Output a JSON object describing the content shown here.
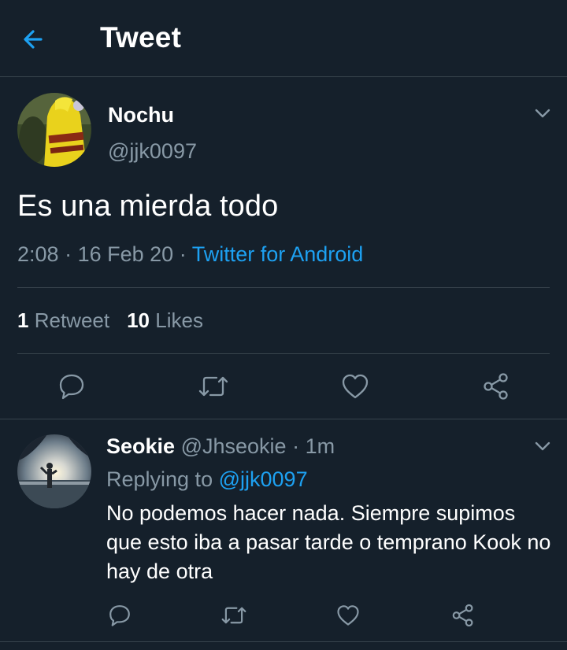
{
  "header": {
    "title": "Tweet",
    "back_icon": "arrow-left-icon"
  },
  "colors": {
    "background": "#15202b",
    "accent": "#1da1f2",
    "secondary_text": "#8899a6",
    "divider": "#38444d"
  },
  "tweet": {
    "author_name": "Nochu",
    "author_handle": "@jjk0097",
    "text": "Es una mierda todo",
    "time": "2:08",
    "date": "16 Feb 20",
    "source": "Twitter for Android",
    "retweet_count": "1",
    "retweet_label": "Retweet",
    "like_count": "10",
    "like_label": "Likes",
    "actions": [
      "reply-icon",
      "retweet-icon",
      "like-icon",
      "share-icon"
    ]
  },
  "reply": {
    "author_name": "Seokie",
    "author_handle": "@Jhseokie",
    "time_ago": "1m",
    "replying_label": "Replying to",
    "replying_to": "@jjk0097",
    "text": "No podemos hacer nada. Siempre supimos que esto iba a pasar tarde o temprano Kook no hay de otra",
    "actions": [
      "reply-icon",
      "retweet-icon",
      "like-icon",
      "share-icon"
    ]
  }
}
